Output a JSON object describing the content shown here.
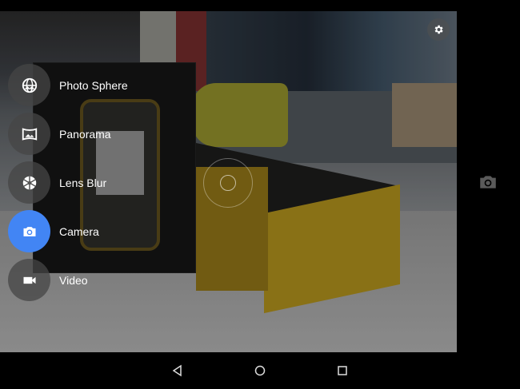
{
  "modes": [
    {
      "label": "Photo Sphere",
      "icon": "photo-sphere-icon",
      "active": false
    },
    {
      "label": "Panorama",
      "icon": "panorama-icon",
      "active": false
    },
    {
      "label": "Lens Blur",
      "icon": "lens-blur-icon",
      "active": false
    },
    {
      "label": "Camera",
      "icon": "camera-icon",
      "active": true
    },
    {
      "label": "Video",
      "icon": "video-icon",
      "active": false
    }
  ],
  "colors": {
    "accent": "#4285f4"
  },
  "settings_icon": "gear-icon",
  "shutter_icon": "camera-icon",
  "nav": [
    "back-icon",
    "home-icon",
    "recents-icon"
  ]
}
